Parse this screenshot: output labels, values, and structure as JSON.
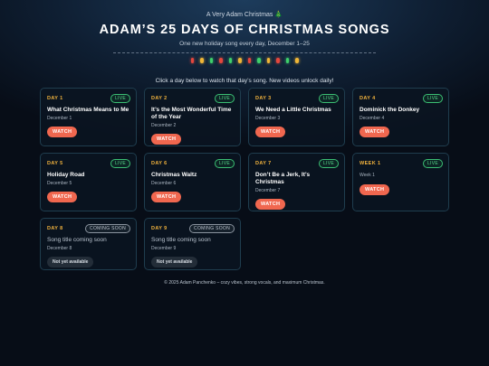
{
  "header": {
    "kicker": "A Very Adam Christmas 🎄",
    "title": "ADAM’S 25 DAYS OF CHRISTMAS SONGS",
    "subtitle": "One new holiday song every day, December 1–25",
    "light_colors": [
      "#e4473d",
      "#f0b637",
      "#3fcf6b",
      "#e4473d",
      "#3fcf6b",
      "#f0b637",
      "#e4473d",
      "#3fcf6b",
      "#f0b637",
      "#e4473d",
      "#3fcf6b",
      "#f0b637"
    ]
  },
  "instructions": "Click a day below to watch that day’s song. New videos unlock daily!",
  "cards": [
    {
      "day": "DAY 1",
      "badge": "LIVE",
      "song": "What Christmas Means to Me",
      "date": "December 1",
      "action": "WATCH"
    },
    {
      "day": "DAY 2",
      "badge": "LIVE",
      "song": "It’s the Most Wonderful Time of the Year",
      "date": "December 2",
      "action": "WATCH"
    },
    {
      "day": "DAY 3",
      "badge": "LIVE",
      "song": "We Need a Little Christmas",
      "date": "December 3",
      "action": "WATCH"
    },
    {
      "day": "DAY 4",
      "badge": "LIVE",
      "song": "Dominick the Donkey",
      "date": "December 4",
      "action": "WATCH"
    },
    {
      "day": "DAY 5",
      "badge": "LIVE",
      "song": "Holiday Road",
      "date": "December 5",
      "action": "WATCH"
    },
    {
      "day": "DAY 6",
      "badge": "LIVE",
      "song": "Christmas Waltz",
      "date": "December 6",
      "action": "WATCH"
    },
    {
      "day": "DAY 7",
      "badge": "LIVE",
      "song": "Don’t Be a Jerk, It’s Christmas",
      "date": "December 7",
      "action": "WATCH"
    },
    {
      "day": "WEEK 1",
      "badge": "LIVE",
      "song": "",
      "date": "Week 1",
      "action": "WATCH"
    },
    {
      "day": "DAY 8",
      "badge": "COMING SOON",
      "song": "Song title coming soon",
      "date": "December 8",
      "action": "Not yet available"
    },
    {
      "day": "DAY 9",
      "badge": "COMING SOON",
      "song": "Song title coming soon",
      "date": "December 9",
      "action": "Not yet available"
    }
  ],
  "footer": "© 2025 Adam Panchenko – cozy vibes, strong vocals, and maximum Christmas."
}
